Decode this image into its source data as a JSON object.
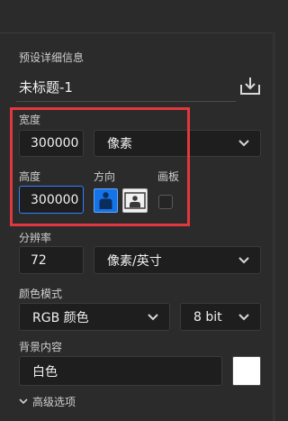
{
  "header": {
    "title": "预设详细信息",
    "preset_name": "未标题-1",
    "save_icon": "save-preset-icon"
  },
  "dimensions": {
    "width_label": "宽度",
    "width_value": "300000",
    "width_unit": "像素",
    "height_label": "高度",
    "height_value": "300000",
    "orientation_label": "方向",
    "artboard_label": "画板",
    "orientation_selected": "portrait",
    "artboard_checked": false
  },
  "resolution": {
    "label": "分辨率",
    "value": "72",
    "unit": "像素/英寸"
  },
  "color_mode": {
    "label": "颜色模式",
    "mode": "RGB 颜色",
    "depth": "8 bit"
  },
  "background": {
    "label": "背景内容",
    "value": "白色",
    "swatch_color": "#ffffff"
  },
  "advanced": {
    "label": "高级选项"
  },
  "colors": {
    "highlight": "#e0383e",
    "focus": "#2f80ff",
    "portrait_active": "#1473e6"
  }
}
